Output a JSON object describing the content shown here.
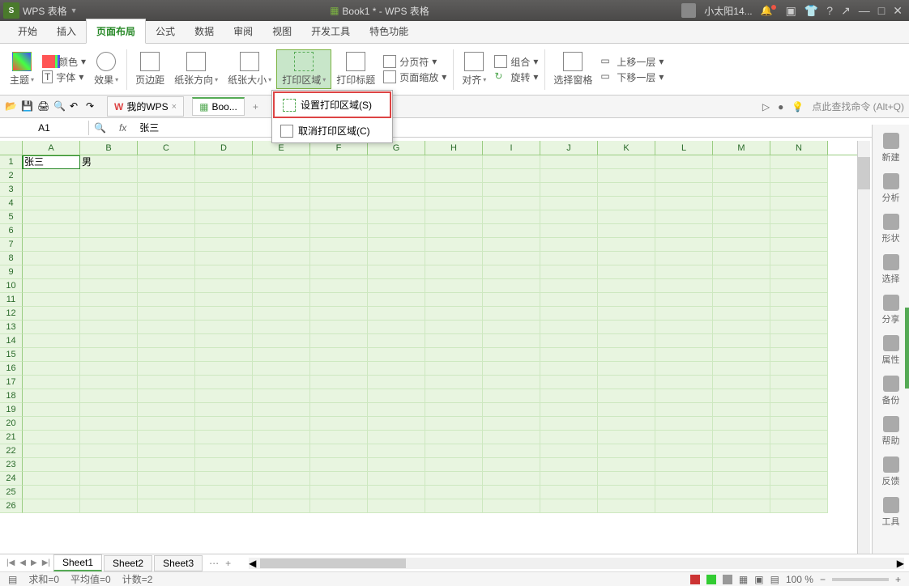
{
  "titlebar": {
    "app_name": "WPS 表格",
    "doc_title": "Book1 * - WPS 表格",
    "user_name": "小太阳14..."
  },
  "menutabs": {
    "items": [
      "开始",
      "插入",
      "页面布局",
      "公式",
      "数据",
      "审阅",
      "视图",
      "开发工具",
      "特色功能"
    ],
    "active_index": 2
  },
  "ribbon": {
    "theme": "主题",
    "color": "颜色",
    "font": "字体",
    "effect": "效果",
    "margin": "页边距",
    "orientation": "纸张方向",
    "size": "纸张大小",
    "print_area": "打印区域",
    "print_title": "打印标题",
    "breaks": "分页符",
    "scale": "页面缩放",
    "align": "对齐",
    "rotate": "旋转",
    "group": "组合",
    "select_pane": "选择窗格",
    "move_up": "上移一层",
    "move_down": "下移一层"
  },
  "dropdown": {
    "set_area": "设置打印区域(S)",
    "cancel_area": "取消打印区域(C)"
  },
  "docbar": {
    "mywps": "我的WPS",
    "book": "Boo...",
    "hint": "点此查找命令 (Alt+Q)"
  },
  "fbar": {
    "name": "A1",
    "fx": "fx",
    "value": "张三"
  },
  "grid": {
    "columns": [
      "A",
      "B",
      "C",
      "D",
      "E",
      "F",
      "G",
      "H",
      "I",
      "J",
      "K",
      "L",
      "M",
      "N"
    ],
    "rows": 26,
    "cells": {
      "A1": "张三",
      "B1": "男"
    }
  },
  "sidepanel": {
    "items": [
      "新建",
      "分析",
      "形状",
      "选择",
      "分享",
      "属性",
      "备份",
      "帮助",
      "反馈",
      "工具"
    ]
  },
  "sheets": {
    "items": [
      "Sheet1",
      "Sheet2",
      "Sheet3"
    ],
    "active_index": 0
  },
  "statusbar": {
    "sum": "求和=0",
    "avg": "平均值=0",
    "count": "计数=2",
    "zoom": "100 %"
  }
}
